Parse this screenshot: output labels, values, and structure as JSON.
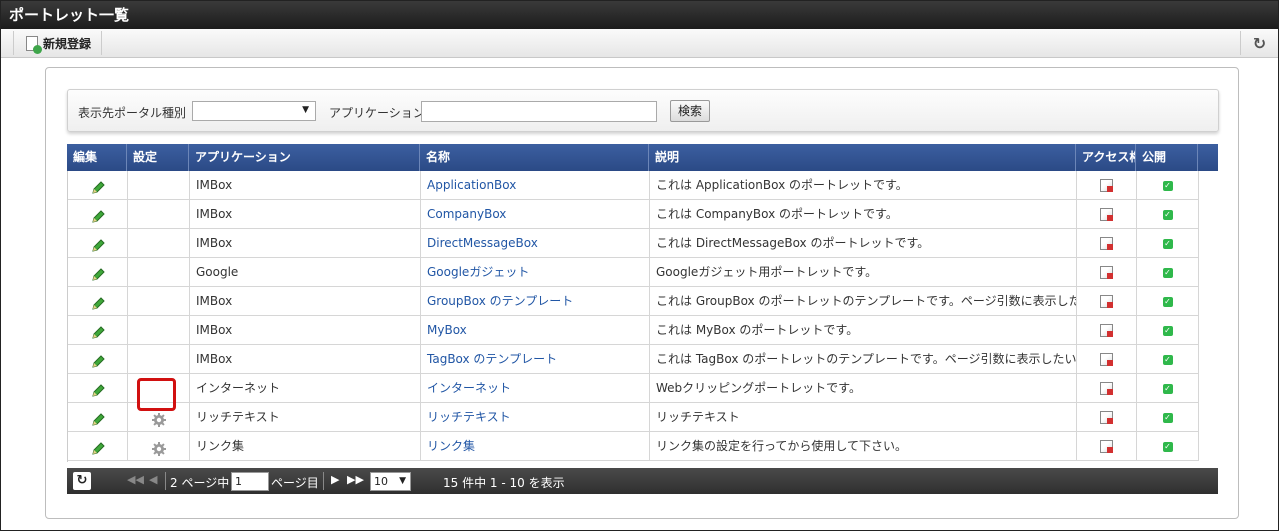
{
  "window": {
    "title": "ポートレット一覧"
  },
  "toolbar": {
    "new_label": "新規登録",
    "refresh_glyph": "↻"
  },
  "search": {
    "portal_type_label": "表示先ポータル種別",
    "portal_type_value": "",
    "application_label": "アプリケーション",
    "application_value": "",
    "search_button": "検索"
  },
  "grid": {
    "columns": [
      "編集",
      "設定",
      "アプリケーション",
      "名称",
      "説明",
      "アクセス権",
      "公開"
    ],
    "rows": [
      {
        "app": "IMBox",
        "name": "ApplicationBox",
        "desc": "これは ApplicationBox のポートレットです。",
        "settings": false
      },
      {
        "app": "IMBox",
        "name": "CompanyBox",
        "desc": "これは CompanyBox のポートレットです。",
        "settings": false
      },
      {
        "app": "IMBox",
        "name": "DirectMessageBox",
        "desc": "これは DirectMessageBox のポートレットです。",
        "settings": false
      },
      {
        "app": "Google",
        "name": "Googleガジェット",
        "desc": "Googleガジェット用ポートレットです。",
        "settings": false
      },
      {
        "app": "IMBox",
        "name": "GroupBox のテンプレート",
        "desc": "これは GroupBox のポートレットのテンプレートです。ページ引数に表示したいグループ",
        "settings": false
      },
      {
        "app": "IMBox",
        "name": "MyBox",
        "desc": "これは MyBox のポートレットです。",
        "settings": false
      },
      {
        "app": "IMBox",
        "name": "TagBox のテンプレート",
        "desc": "これは TagBox のポートレットのテンプレートです。ページ引数に表示したいタグ名を",
        "settings": false
      },
      {
        "app": "インターネット",
        "name": "インターネット",
        "desc": "Webクリッピングポートレットです。",
        "settings": false
      },
      {
        "app": "リッチテキスト",
        "name": "リッチテキスト",
        "desc": "リッチテキスト",
        "settings": true
      },
      {
        "app": "リンク集",
        "name": "リンク集",
        "desc": "リンク集の設定を行ってから使用して下さい。",
        "settings": true
      }
    ]
  },
  "pager": {
    "page_prefix": "2 ページ中",
    "page_value": "1",
    "page_suffix": "ページ目",
    "page_size": "10",
    "summary": "15 件中 1 - 10 を表示"
  },
  "colors": {
    "header_blue": "#2f4f8f",
    "link": "#2156a5",
    "highlight": "#d11010",
    "footer": "#3a3a3a"
  }
}
